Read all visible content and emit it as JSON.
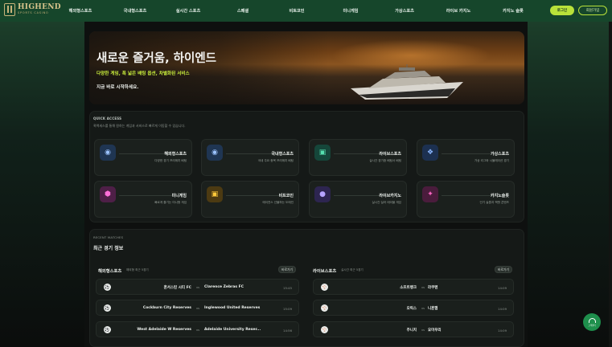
{
  "brand": {
    "name": "HIGHEND",
    "tagline": "SPORTS CASINO"
  },
  "nav": [
    "해외형스포츠",
    "국내형스포츠",
    "실시간 스포츠",
    "스페셜",
    "비트코인",
    "미니게임",
    "가상스포츠",
    "라이브 카지노",
    "카지노 슬롯"
  ],
  "auth": {
    "login": "로그인",
    "join": "회원가입"
  },
  "hero": {
    "title": "새로운 즐거움, 하이엔드",
    "subtitle": "다양한 게임, 폭 넓은 배팅 옵션, 차별화된 서비스",
    "cta": "지금 바로 시작하세요."
  },
  "quick_access": {
    "label": "QUICK ACCESS",
    "description": "퀵액세스를 통해 원하는 게임과 서비스로 빠르게 이동할 수 있습니다.",
    "items": [
      {
        "title": "해외형스포츠",
        "sub": "다양한 경기 프리매치 배팅",
        "icon": "soccer-ball-icon",
        "color": "#3a5a8c"
      },
      {
        "title": "국내형스포츠",
        "sub": "국내 주요 종목 프리매치 배팅",
        "icon": "soccer-ball-icon",
        "color": "#3a5a8c"
      },
      {
        "title": "라이브스포츠",
        "sub": "실시간 경기중 베팅서 배팅",
        "icon": "live-tv-icon",
        "color": "#1f6b57"
      },
      {
        "title": "가상스포츠",
        "sub": "가상 리그와 시뮬레이션 경기",
        "icon": "gamepad-icon",
        "color": "#2e4d7a"
      },
      {
        "title": "미니게임",
        "sub": "빠르게 즐기는 미니형 게임",
        "icon": "cube-icon",
        "color": "#7d2a6d"
      },
      {
        "title": "비트코인",
        "sub": "에이전스 선물하는 도메인",
        "icon": "basket-icon",
        "color": "#8a6a1a"
      },
      {
        "title": "라이브카지노",
        "sub": "실시간 딜러 테이블 게임",
        "icon": "controller-icon",
        "color": "#4a3a7a"
      },
      {
        "title": "카지노슬롯",
        "sub": "인기 슬롯과 잭팟 콘텐츠",
        "icon": "sparkle-icon",
        "color": "#7a2a5a"
      }
    ]
  },
  "recent": {
    "label": "RECENT MATCHES",
    "title": "최근 경기 정보",
    "more": "바로가기",
    "overseas": {
      "title": "해외형스포츠",
      "sub": "해외형 최근 5경기",
      "matches": [
        {
          "home": "혼서스틴 시티 FC",
          "away": "Clarence Zebras FC",
          "time": "15:45"
        },
        {
          "home": "Cockburn City Reserves",
          "away": "Inglewood United Reserves",
          "time": "15:09"
        },
        {
          "home": "West Adelaide W Reserves",
          "away": "Adelaide University Reser...",
          "time": "14:56"
        }
      ]
    },
    "live": {
      "title": "라이브스포츠",
      "sub": "실시간 최근 5경기",
      "matches": [
        {
          "home": "소프트뱅크",
          "away": "라쿠텐",
          "time": "14:09"
        },
        {
          "home": "오릭스",
          "away": "니혼햄",
          "time": "14:09"
        },
        {
          "home": "주니치",
          "away": "요미우리",
          "time": "14:09"
        }
      ]
    }
  },
  "chat": {
    "label": "고객센터"
  }
}
